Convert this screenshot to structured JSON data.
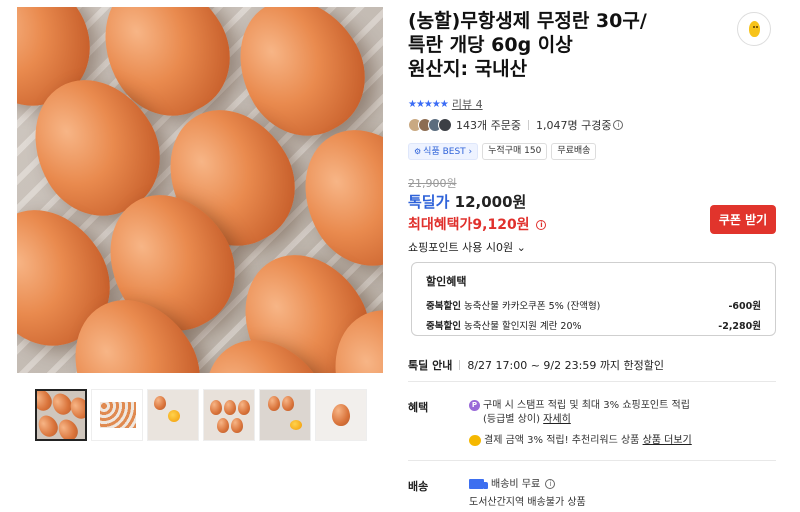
{
  "product": {
    "title_lines": [
      "(농할)무항생제 무정란 30구/",
      "특란 개당 60g 이상",
      "원산지: 국내산"
    ],
    "rating_stars": "★★★★★",
    "review_label": "리뷰 4",
    "orders": "143개 주문중",
    "subscribers": "1,047명 구경중",
    "badges": [
      "식품 BEST",
      "누적구매 150",
      "무료배송"
    ]
  },
  "pricing": {
    "original_price": "21,900원",
    "deal_label": "톡딜가",
    "deal_price": "12,000원",
    "max_benefit": "최대혜택가9,120원",
    "coupon_button": "쿠폰 받기",
    "points_label": "쇼핑포인트 사용 시0원"
  },
  "discount": {
    "header": "할인혜택",
    "rows": [
      {
        "kind": "중복할인",
        "desc": "농축산물 카카오쿠폰 5% (잔액형)",
        "amount": "-600원"
      },
      {
        "kind": "중복할인",
        "desc": "농축산물 할인지원 계란 20%",
        "amount": "-2,280원"
      }
    ]
  },
  "sale_notice": {
    "label": "톡딜 안내",
    "period": "8/27 17:00 ~ 9/2 23:59 까지 한정할인"
  },
  "benefit": {
    "label": "혜택",
    "line1": "구매 시 스탬프 적립 및 최대 3% 쇼핑포인트 적립",
    "line1b": "(등급별 상이)",
    "line1_link": "자세히",
    "line2": "결제 금액 3% 적립! 추천리워드 상품",
    "line2_link": "상품 더보기"
  },
  "shipping": {
    "label": "배송",
    "fee": "배송비 무료",
    "note": "도서산간지역 배송불가 상품"
  },
  "icons": {
    "p_icon": "P",
    "info_icon": "i"
  }
}
